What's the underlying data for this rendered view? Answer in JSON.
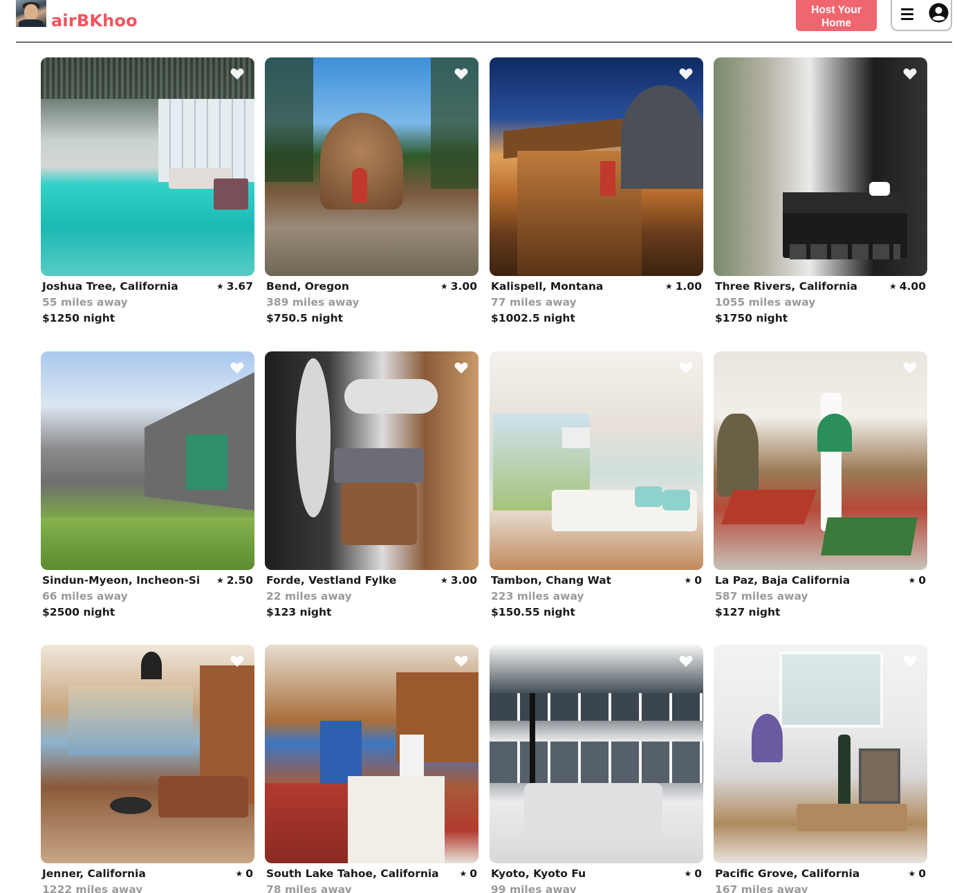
{
  "header": {
    "logo_text": "airBKhoo",
    "host_button_label": "Host Your Home",
    "menu_icon": "hamburger-menu-icon",
    "user_icon": "user-circle-icon",
    "brand_color": "#f0555f"
  },
  "listings": [
    {
      "location": "Joshua Tree, California",
      "rating": "3.67",
      "distance": "55 miles away",
      "price": "$1250 night"
    },
    {
      "location": "Bend, Oregon",
      "rating": "3.00",
      "distance": "389 miles away",
      "price": "$750.5 night"
    },
    {
      "location": "Kalispell, Montana",
      "rating": "1.00",
      "distance": "77 miles away",
      "price": "$1002.5 night"
    },
    {
      "location": "Three Rivers, California",
      "rating": "4.00",
      "distance": "1055 miles away",
      "price": "$1750 night"
    },
    {
      "location": "Sindun-Myeon, Incheon-Si",
      "rating": "2.50",
      "distance": "66 miles away",
      "price": "$2500 night"
    },
    {
      "location": "Forde, Vestland Fylke",
      "rating": "3.00",
      "distance": "22 miles away",
      "price": "$123 night"
    },
    {
      "location": "Tambon, Chang Wat",
      "rating": "0",
      "distance": "223 miles away",
      "price": "$150.55 night"
    },
    {
      "location": "La Paz, Baja California",
      "rating": "0",
      "distance": "587 miles away",
      "price": "$127 night"
    },
    {
      "location": "Jenner, California",
      "rating": "0",
      "distance": "1222 miles away",
      "price": ""
    },
    {
      "location": "South Lake Tahoe, California",
      "rating": "0",
      "distance": "78 miles away",
      "price": ""
    },
    {
      "location": "Kyoto, Kyoto Fu",
      "rating": "0",
      "distance": "99 miles away",
      "price": ""
    },
    {
      "location": "Pacific Grove, California",
      "rating": "0",
      "distance": "167 miles away",
      "price": ""
    }
  ],
  "star_glyph": "★"
}
